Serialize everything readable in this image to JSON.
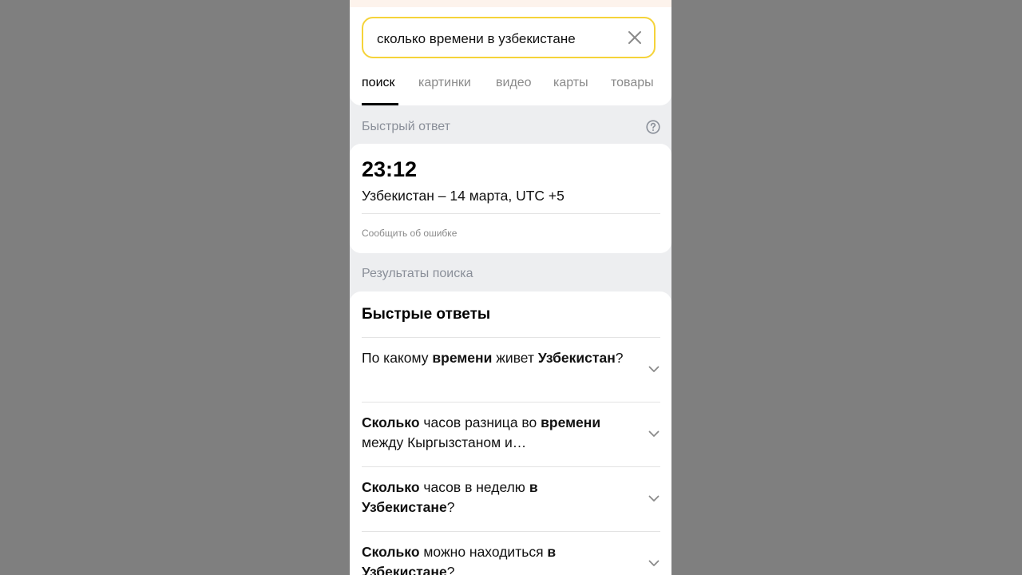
{
  "search": {
    "query": "сколько времени в узбекистане"
  },
  "tabs": [
    {
      "label": "поиск",
      "active": true
    },
    {
      "label": "картинки",
      "active": false
    },
    {
      "label": "видео",
      "active": false
    },
    {
      "label": "карты",
      "active": false
    },
    {
      "label": "товары",
      "active": false
    }
  ],
  "quick_answer": {
    "section_label": "Быстрый ответ",
    "time": "23:12",
    "place": "Узбекистан – 14 марта, UTC +5",
    "report_link": "Сообщить об ошибке"
  },
  "results": {
    "section_label": "Результаты поиска",
    "title": "Быстрые ответы",
    "items": [
      {
        "parts": [
          {
            "text": "По какому ",
            "bold": false
          },
          {
            "text": "времени",
            "bold": true
          },
          {
            "text": " живет ",
            "bold": false
          },
          {
            "text": "Узбекистан",
            "bold": true
          },
          {
            "text": "?",
            "bold": false
          }
        ]
      },
      {
        "parts": [
          {
            "text": "Сколько",
            "bold": true
          },
          {
            "text": " часов разница во ",
            "bold": false
          },
          {
            "text": "времени",
            "bold": true
          },
          {
            "text": " между Кыргызстаном и…",
            "bold": false
          }
        ]
      },
      {
        "parts": [
          {
            "text": "Сколько",
            "bold": true
          },
          {
            "text": " часов в неделю ",
            "bold": false
          },
          {
            "text": "в Узбекистане",
            "bold": true
          },
          {
            "text": "?",
            "bold": false
          }
        ]
      },
      {
        "parts": [
          {
            "text": "Сколько",
            "bold": true
          },
          {
            "text": " можно находиться ",
            "bold": false
          },
          {
            "text": "в Узбекистане",
            "bold": true
          },
          {
            "text": "?",
            "bold": false
          }
        ]
      }
    ]
  },
  "colors": {
    "search_border": "#f5d33a",
    "page_background": "#edeef0",
    "outer_background": "#7f7f7f"
  }
}
